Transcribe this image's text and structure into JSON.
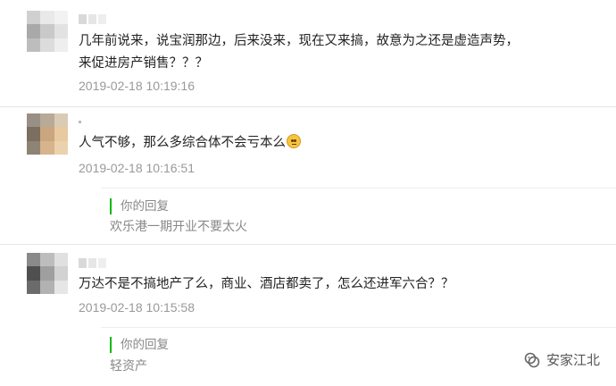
{
  "comments": [
    {
      "text_line1": "几年前说来，说宝润那边，后来没来，现在又来搞，故意为之还是虚造声势，",
      "text_line2": "来促进房产销售？？？",
      "time": "2019-02-18 10:19:16"
    },
    {
      "text": "人气不够，那么多综合体不会亏本么",
      "emoji_icon": "pensive-face-emoji",
      "time": "2019-02-18 10:16:51",
      "reply_label": "你的回复",
      "reply_text": "欢乐港一期开业不要太火"
    },
    {
      "text": "万达不是不搞地产了么，商业、酒店都卖了，怎么还进军六合？？",
      "time": "2019-02-18 10:15:58",
      "reply_label": "你的回复",
      "reply_text": "轻资产"
    }
  ],
  "watermark": {
    "text": "安家江北",
    "icon": "wechat-official-account-icon"
  },
  "colors": {
    "reply_accent": "#09bb07",
    "timestamp": "#999999",
    "comment_text": "#222222"
  }
}
